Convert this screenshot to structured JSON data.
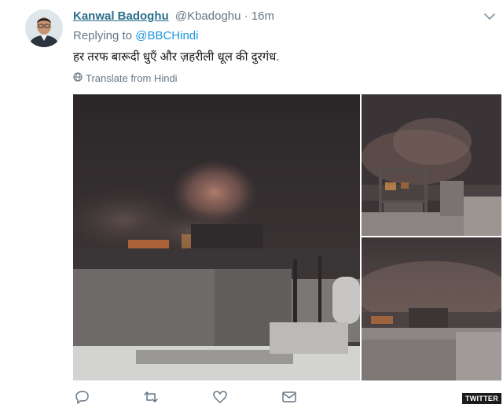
{
  "tweet": {
    "author_name": "Kanwal Badoghu",
    "handle": "@Kbadoghu",
    "separator": "·",
    "time": "16m",
    "replying_prefix": "Replying to",
    "replying_to": "@BBCHindi",
    "text": "हर तरफ बारूदी धुएँ और ज़हरीली धूल की दुरगंध.",
    "translate_label": "Translate from Hindi"
  },
  "icons": {
    "menu": "chevron-down-icon",
    "translate": "globe-icon",
    "reply": "reply-icon",
    "retweet": "retweet-icon",
    "like": "heart-icon",
    "message": "envelope-icon"
  },
  "brand": {
    "watermark": "TWITTER"
  },
  "colors": {
    "author": "#2a6f8b",
    "link": "#1b95e0",
    "muted": "#657786"
  }
}
